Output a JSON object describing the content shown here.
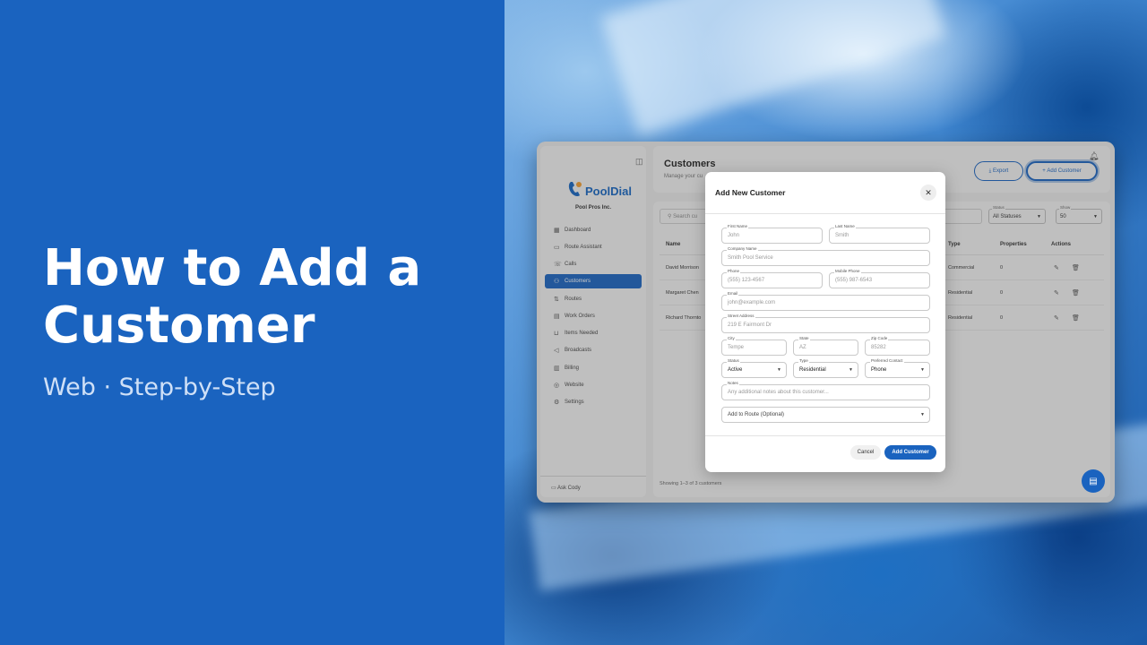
{
  "hero": {
    "title": "How to Add a Customer",
    "subtitle": "Web · Step-by-Step"
  },
  "colors": {
    "brand_blue": "#1a63bf",
    "panel_bg": "#f2f2f2"
  },
  "sidebar": {
    "logo_text": "PoolDial",
    "company": "Pool Pros Inc.",
    "items": [
      {
        "label": "Dashboard",
        "icon": "dashboard-icon"
      },
      {
        "label": "Route Assistant",
        "icon": "chat-icon"
      },
      {
        "label": "Calls",
        "icon": "phone-icon"
      },
      {
        "label": "Customers",
        "icon": "people-icon"
      },
      {
        "label": "Routes",
        "icon": "routes-icon"
      },
      {
        "label": "Work Orders",
        "icon": "clipboard-icon"
      },
      {
        "label": "Items Needed",
        "icon": "cart-icon"
      },
      {
        "label": "Broadcasts",
        "icon": "megaphone-icon"
      },
      {
        "label": "Billing",
        "icon": "billing-icon"
      },
      {
        "label": "Website",
        "icon": "globe-icon"
      },
      {
        "label": "Settings",
        "icon": "gear-icon"
      }
    ],
    "ask": "Ask Cody"
  },
  "header": {
    "title": "Customers",
    "subtitle": "Manage your cu",
    "export": "Export",
    "add": "Add Customer"
  },
  "filters": {
    "search_placeholder": "Search cu",
    "status_label": "Status",
    "status_value": "All Statuses",
    "show_label": "Show",
    "show_value": "50"
  },
  "table": {
    "columns": {
      "name": "Name",
      "type": "Type",
      "properties": "Properties",
      "actions": "Actions"
    },
    "rows": [
      {
        "name": "David Morrison",
        "type": "Commercial",
        "properties": "0"
      },
      {
        "name": "Margaret Chen",
        "type": "Residential",
        "properties": "0"
      },
      {
        "name": "Richard Thornto",
        "type": "Residential",
        "properties": "0"
      }
    ],
    "footer": "Showing 1–3 of 3 customers"
  },
  "modal": {
    "title": "Add New Customer",
    "first_name": {
      "label": "First Name",
      "placeholder": "John"
    },
    "last_name": {
      "label": "Last Name",
      "placeholder": "Smith"
    },
    "company": {
      "label": "Company Name",
      "placeholder": "Smith Pool Service"
    },
    "phone": {
      "label": "Phone",
      "placeholder": "(555) 123-4567"
    },
    "mobile": {
      "label": "Mobile Phone",
      "placeholder": "(555) 987-6543"
    },
    "email": {
      "label": "Email",
      "placeholder": "john@example.com"
    },
    "street": {
      "label": "Street Address",
      "placeholder": "219 E Fairmont Dr"
    },
    "city": {
      "label": "City",
      "placeholder": "Tempe"
    },
    "state": {
      "label": "State",
      "placeholder": "AZ"
    },
    "zip": {
      "label": "Zip Code",
      "placeholder": "85282"
    },
    "status": {
      "label": "Status",
      "value": "Active"
    },
    "type": {
      "label": "Type",
      "value": "Residential"
    },
    "contact": {
      "label": "Preferred Contact",
      "value": "Phone"
    },
    "notes": {
      "label": "Notes",
      "placeholder": "Any additional notes about this customer..."
    },
    "route": {
      "placeholder": "Add to Route (Optional)"
    },
    "cancel": "Cancel",
    "submit": "Add Customer"
  }
}
